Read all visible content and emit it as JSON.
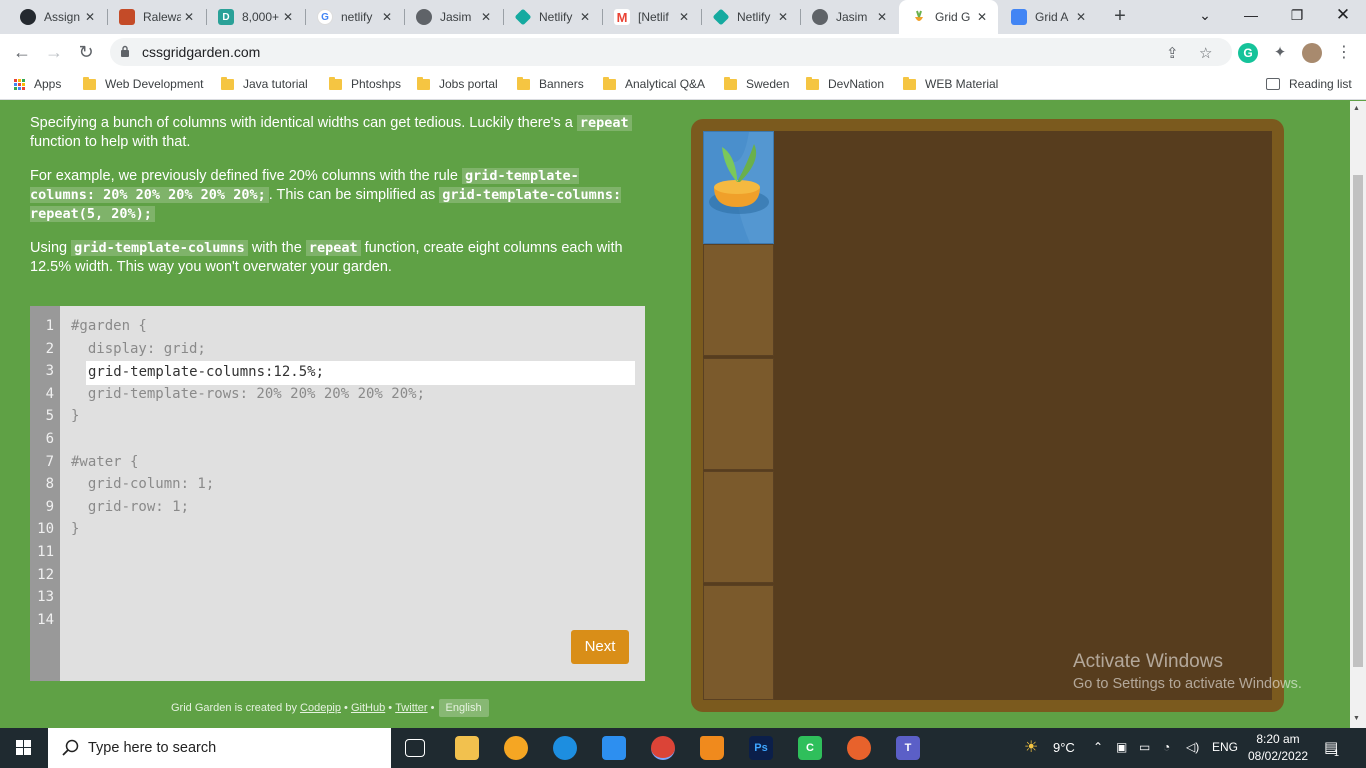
{
  "browser": {
    "tabs": [
      {
        "title": "Assign",
        "favicon": "github-icon",
        "color": "#24292f"
      },
      {
        "title": "Ralewa",
        "favicon": "behance-mosaic-icon",
        "color": "#c44b28"
      },
      {
        "title": "8,000+",
        "favicon": "dribbble-d-icon",
        "color": "#2aa198"
      },
      {
        "title": "netlify",
        "favicon": "google-g-icon",
        "color": "#4285f4"
      },
      {
        "title": "Jasim",
        "favicon": "globe-icon",
        "color": "#5f6368"
      },
      {
        "title": "Netlify",
        "favicon": "netlify-icon",
        "color": "#15aaa0"
      },
      {
        "title": "[Netlif",
        "favicon": "gmail-icon",
        "color": "#ea4335"
      },
      {
        "title": "Netlify",
        "favicon": "netlify-icon",
        "color": "#15aaa0"
      },
      {
        "title": "Jasim",
        "favicon": "globe-icon",
        "color": "#5f6368"
      },
      {
        "title": "Grid G",
        "favicon": "carrot-icon",
        "color": "#f0a02a",
        "active": true
      },
      {
        "title": "Grid A",
        "favicon": "google-docs-icon",
        "color": "#4285f4"
      }
    ],
    "url": "cssgridgarden.com",
    "bookmarks": [
      "Apps",
      "Web Development",
      "Java tutorial",
      "Phtoshps",
      "Jobs portal",
      "Banners",
      "Analytical Q&A",
      "Sweden",
      "DevNation",
      "WEB Material"
    ],
    "reading_list": "Reading list"
  },
  "lesson": {
    "para1_a": "Specifying a bunch of columns with identical widths can get tedious. Luckily there's a",
    "para1_code": "repeat",
    "para1_b": "function to help with that.",
    "para2_a": "For example, we previously defined five 20% columns with the rule",
    "para2_code1": "grid-template-columns: 20% 20% 20% 20% 20%;",
    "para2_b": ". This can be simplified as",
    "para2_code2": "grid-template-columns: repeat(5, 20%);",
    "para3_a": "Using",
    "para3_code1": "grid-template-columns",
    "para3_b": "with the",
    "para3_code2": "repeat",
    "para3_c": "function, create eight columns each with 12.5% width. This way you won't overwater your garden."
  },
  "editor": {
    "line_numbers": [
      "1",
      "2",
      "3",
      "4",
      "5",
      "6",
      "7",
      "8",
      "9",
      "10",
      "11",
      "12",
      "13",
      "14"
    ],
    "line1": "#garden {",
    "line2": "  display: grid;",
    "input_value": "grid-template-columns:12.5%;",
    "line4": "  grid-template-rows: 20% 20% 20% 20% 20%;",
    "line5": "}",
    "line7": "#water {",
    "line8": "  grid-column: 1;",
    "line9": "  grid-row: 1;",
    "line10": "}",
    "next_label": "Next"
  },
  "footer": {
    "text": "Grid Garden is created by",
    "codepip": "Codepip",
    "github": "GitHub",
    "twitter": "Twitter",
    "language": "English"
  },
  "watermark": {
    "title": "Activate Windows",
    "subtitle": "Go to Settings to activate Windows."
  },
  "taskbar": {
    "search_placeholder": "Type here to search",
    "weather": "9°C",
    "language": "ENG",
    "time": "8:20 am",
    "date": "08/02/2022",
    "notification_count": "1"
  }
}
